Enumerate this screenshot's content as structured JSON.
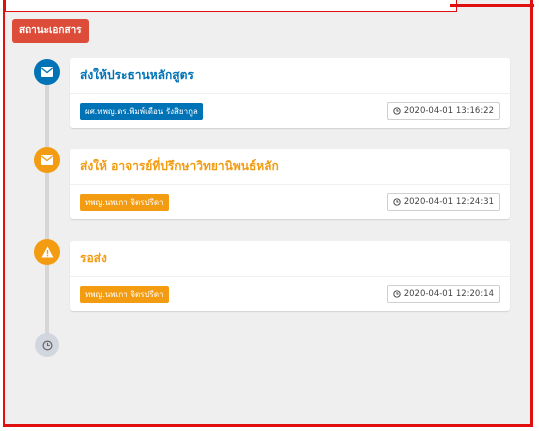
{
  "status_label": "สถานะเอกสาร",
  "colors": {
    "frame_border": "#e01010",
    "status_label_bg": "#dd4b39",
    "blue": "#0073b7",
    "orange": "#f39c12",
    "grey": "#d2d6de"
  },
  "timeline": [
    {
      "icon": "envelope-icon",
      "color": "#0073b7",
      "title": "ส่งให้ประธานหลักสูตร",
      "person": "ผศ.ทพญ.ดร.พิมพ์เดือน รังสิยากูล",
      "timestamp": "2020-04-01 13:16:22"
    },
    {
      "icon": "envelope-icon",
      "color": "#f39c12",
      "title": "ส่งให้ อาจารย์ที่ปรึกษาวิทยานิพนธ์หลัก",
      "person": "ทพญ.นพเกา จิตรปรีดา",
      "timestamp": "2020-04-01 12:24:31"
    },
    {
      "icon": "warning-icon",
      "color": "#f39c12",
      "title": "รอส่ง",
      "person": "ทพญ.นพเกา จิตรปรีดา",
      "timestamp": "2020-04-01 12:20:14"
    }
  ],
  "end_icon": "clock-icon"
}
